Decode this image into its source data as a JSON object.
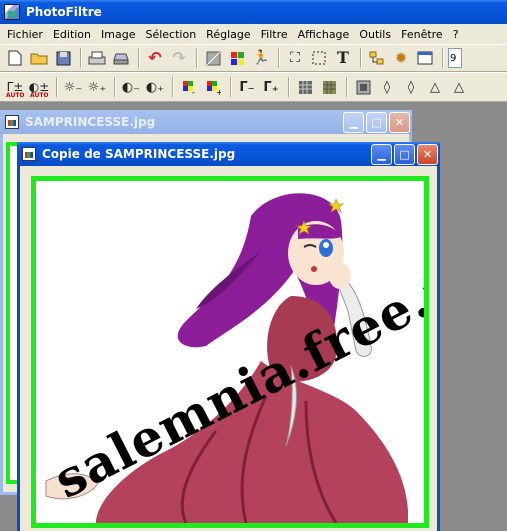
{
  "app": {
    "title": "PhotoFiltre"
  },
  "menu": [
    "Fichier",
    "Edition",
    "Image",
    "Sélection",
    "Réglage",
    "Filtre",
    "Affichage",
    "Outils",
    "Fenêtre",
    "?"
  ],
  "toolbar1": {
    "icons": [
      "new-icon",
      "open-icon",
      "save-icon",
      "print-icon",
      "scan-icon",
      "undo-icon",
      "redo-icon",
      "transparency-icon",
      "color-grid-icon",
      "run-icon",
      "automate-icon",
      "select-icon",
      "text-icon",
      "explorer-icon",
      "plugin-icon",
      "window-icon"
    ],
    "zoom_value": "9"
  },
  "toolbar2": {
    "icons": [
      "auto-levels-icon",
      "auto-contrast-icon",
      "brightness-down-icon",
      "brightness-up-icon",
      "contrast-down-icon",
      "contrast-up-icon",
      "saturation-down-icon",
      "saturation-up-icon",
      "gamma-down-icon",
      "gamma-up-icon",
      "dither-icon",
      "grid-icon",
      "blur-icon",
      "drop-icon",
      "sharpen-icon",
      "triangle-icon",
      "triangle-outline-icon"
    ],
    "auto_label": "AUTO"
  },
  "windows": {
    "back": {
      "title": "SAMPRINCESSE.jpg"
    },
    "front": {
      "title": "Copie de SAMPRINCESSE.jpg"
    }
  },
  "image": {
    "watermark": "salemnia.free.fr"
  },
  "colors": {
    "frame_green": "#1eea1e",
    "title_blue": "#0a5be0",
    "workspace_gray": "#8c8c8c"
  }
}
